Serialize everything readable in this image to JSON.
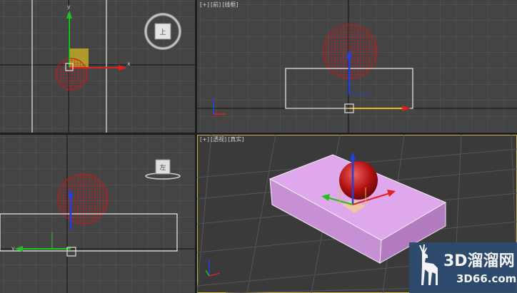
{
  "viewports": {
    "front": {
      "labels": [
        "[+]",
        "[前]",
        "[线框]"
      ]
    },
    "perspective": {
      "labels": [
        "[+]",
        "[透视]",
        "[真实]"
      ]
    }
  },
  "viewcube": {
    "top_face": "上",
    "left_face": "左"
  },
  "axis_labels": {
    "x": "x",
    "y": "y"
  },
  "watermark": {
    "main": "3D溜溜网",
    "sub": "3D66.com"
  },
  "colors": {
    "viewport_bg": "#444444",
    "grid": "#5a5a5a",
    "active_border": "#c8b450",
    "box": "#d79ae0",
    "sphere": "#c01818",
    "axis_x": "#e02020",
    "axis_y": "#20c020",
    "axis_z": "#2040e0"
  },
  "icons": [
    "viewcube-icon",
    "gizmo-icon",
    "deer-logo-icon"
  ]
}
